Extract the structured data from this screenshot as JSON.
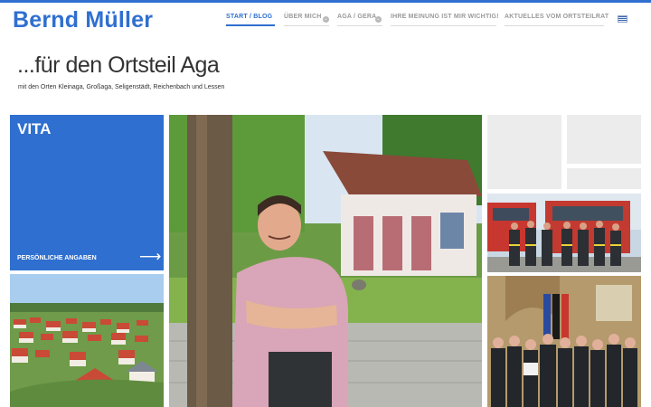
{
  "site": {
    "title": "Bernd Müller",
    "tagline": "...für den Ortsteil Aga",
    "subtagline": "mit den Orten Kleinaga, Großaga, Seligenstädt, Reichenbach und Lessen"
  },
  "nav": {
    "items": [
      {
        "label": "START / BLOG",
        "active": true,
        "dropdown": false
      },
      {
        "label": "ÜBER MICH",
        "active": false,
        "dropdown": true
      },
      {
        "label": "AGA / GERA",
        "active": false,
        "dropdown": true
      },
      {
        "label": "IHRE MEINUNG IST MIR WICHTIG!",
        "active": false,
        "dropdown": false
      },
      {
        "label": "AKTUELLES VOM ORTSTEILRAT",
        "active": false,
        "dropdown": false
      }
    ],
    "language_icon": "flag-icon"
  },
  "tiles": {
    "vita": {
      "title": "VITA",
      "subtitle": "PERSÖNLICHE ANGABEN",
      "arrow_icon": "arrow-right-icon"
    }
  },
  "colors": {
    "accent": "#2f6fd0",
    "placeholder": "#ececec",
    "text": "#333333",
    "nav_inactive": "#9a9a9a"
  }
}
